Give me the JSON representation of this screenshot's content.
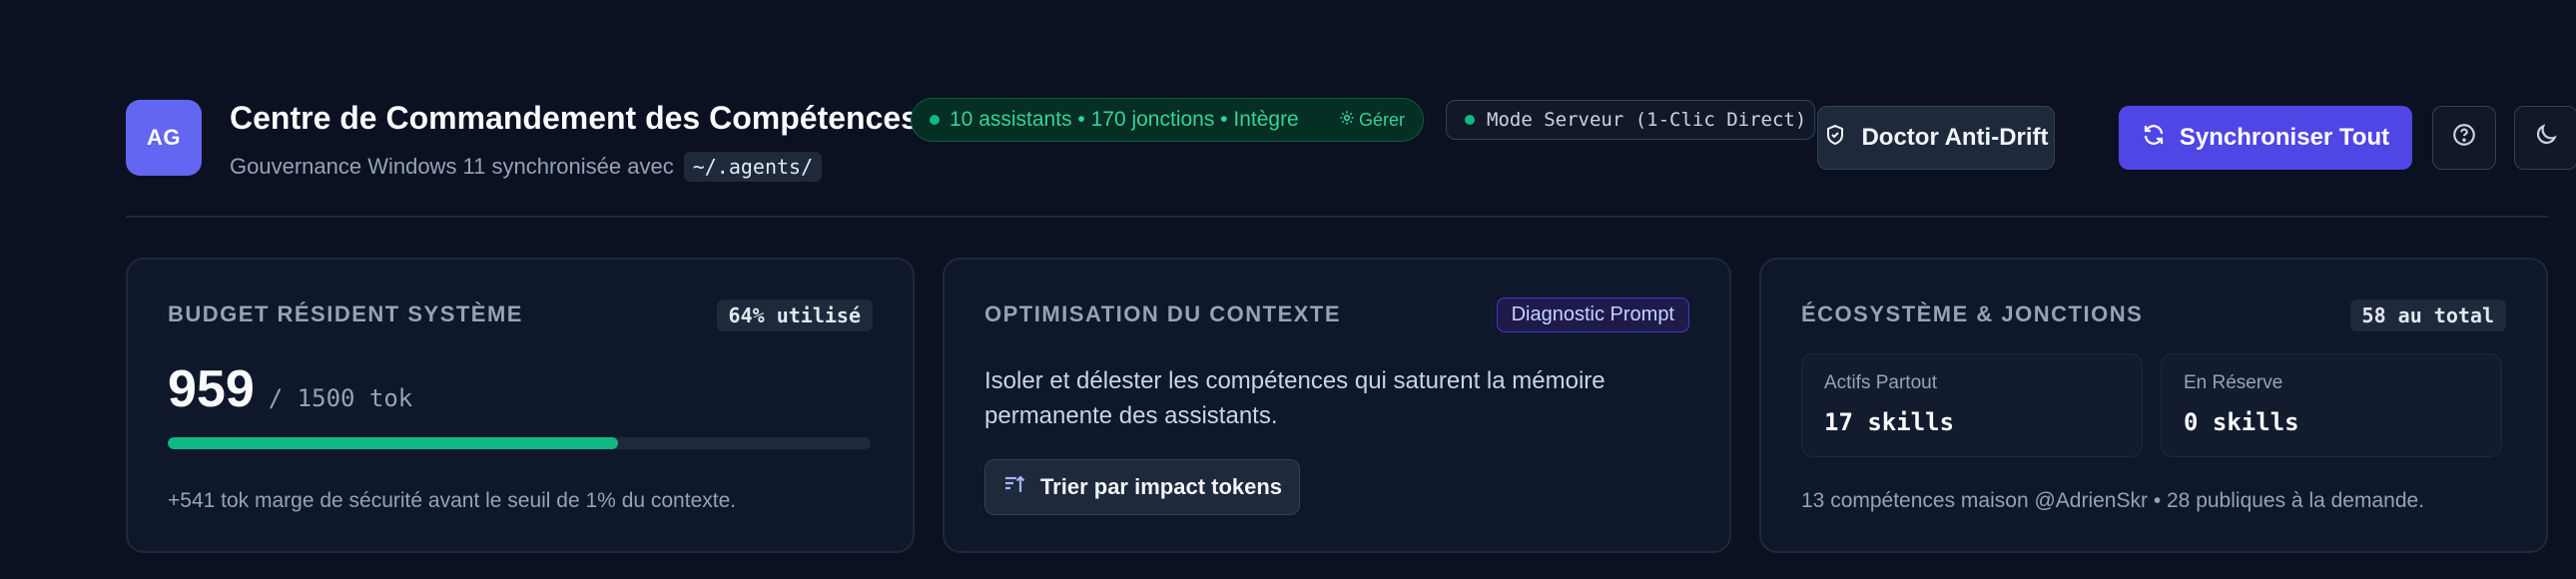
{
  "header": {
    "avatar_initials": "AG",
    "title": "Centre de Commandement des Compétences",
    "subtitle": "Gouvernance Windows 11 synchronisée avec",
    "path_chip": "~/.agents/",
    "status_pill": {
      "text": "10 assistants • 170 jonctions • Intègre",
      "action": "Gérer",
      "action_icon": "gear-icon",
      "color": "#10b981"
    },
    "mode_pill": {
      "text": "Mode Serveur (1-Clic Direct)"
    },
    "buttons": {
      "doctor": {
        "label": "Doctor Anti-Drift",
        "icon": "shield-check-icon"
      },
      "sync": {
        "label": "Synchroniser Tout",
        "icon": "refresh-icon",
        "color": "#4f46e5"
      },
      "help_icon": "help-circle-icon",
      "theme_icon": "moon-icon"
    }
  },
  "cards": {
    "budget": {
      "title": "BUDGET RÉSIDENT SYSTÈME",
      "badge": "64% utilisé",
      "value": "959",
      "total": "/ 1500 tok",
      "progress": 0.64,
      "note": "+541 tok marge de sécurité avant le seuil de 1% du contexte."
    },
    "context": {
      "title": "OPTIMISATION DU CONTEXTE",
      "badge": "Diagnostic Prompt",
      "description": "Isoler et délester les compétences qui saturent la mémoire permanente des assistants.",
      "button": {
        "label": "Trier par impact tokens",
        "icon": "sort-icon"
      }
    },
    "ecosystem": {
      "title": "ÉCOSYSTÈME & JONCTIONS",
      "badge": "58 au total",
      "stats": [
        {
          "label": "Actifs Partout",
          "value": "17 skills"
        },
        {
          "label": "En Réserve",
          "value": "0 skills"
        }
      ],
      "note": "13 compétences maison @AdrienSkr • 28 publiques à la demande."
    }
  },
  "colors": {
    "background": "#0b1120",
    "accent": "#6366f1",
    "success": "#10b981",
    "primary_button": "#4f46e5"
  }
}
